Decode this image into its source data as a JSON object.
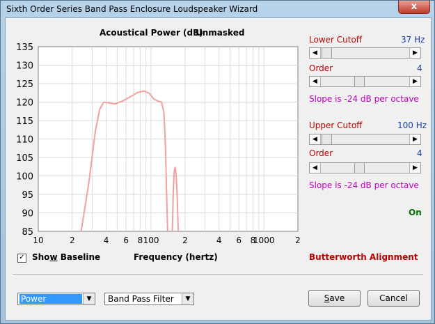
{
  "window": {
    "title": "Sixth Order Series Band Pass Enclosure Loudspeaker Wizard",
    "close_glyph": "x"
  },
  "chart": {
    "title": "Acoustical Power (dB)",
    "subtitle": "Unmasked"
  },
  "chart_data": {
    "type": "line",
    "title": "Acoustical Power (dB)",
    "subtitle": "Unmasked",
    "xlabel": "Frequency (hertz)",
    "ylabel": "",
    "x_scale": "log",
    "xlim": [
      10,
      2000
    ],
    "ylim": [
      85,
      135
    ],
    "grid": true,
    "y_ticks": [
      135,
      130,
      125,
      120,
      115,
      110,
      105,
      100,
      95,
      90,
      85
    ],
    "x_ticks": [
      {
        "value": 10,
        "label": "10"
      },
      {
        "value": 20,
        "label": "2"
      },
      {
        "value": 40,
        "label": "4"
      },
      {
        "value": 60,
        "label": "6"
      },
      {
        "value": 80,
        "label": "8"
      },
      {
        "value": 100,
        "label": "100"
      },
      {
        "value": 200,
        "label": "2"
      },
      {
        "value": 400,
        "label": "4"
      },
      {
        "value": 600,
        "label": "6"
      },
      {
        "value": 800,
        "label": "8"
      },
      {
        "value": 1000,
        "label": "1000"
      },
      {
        "value": 2000,
        "label": "2"
      }
    ],
    "line_color": "#f2a0a0",
    "series": [
      {
        "segments": [
          [
            [
              24,
              85
            ],
            [
              28,
              98
            ],
            [
              32,
              112
            ],
            [
              35,
              118
            ],
            [
              38,
              120
            ],
            [
              42,
              119.8
            ],
            [
              48,
              119.5
            ],
            [
              56,
              120.3
            ],
            [
              66,
              121.5
            ],
            [
              76,
              122.6
            ],
            [
              86,
              123
            ],
            [
              96,
              122.4
            ],
            [
              106,
              120.8
            ],
            [
              116,
              120.2
            ],
            [
              124,
              120
            ],
            [
              130,
              117
            ],
            [
              134,
              108
            ],
            [
              137,
              96
            ],
            [
              140,
              85
            ]
          ],
          [
            [
              154,
              85
            ],
            [
              157,
              95
            ],
            [
              160,
              101
            ],
            [
              163,
              102.3
            ],
            [
              166,
              101
            ],
            [
              170,
              95
            ],
            [
              174,
              85
            ]
          ]
        ]
      }
    ]
  },
  "lower": {
    "cutoff_label": "Lower Cutoff",
    "cutoff_value": "37 Hz",
    "order_label": "Order",
    "order_value": "4",
    "slope": "Slope is -24 dB per octave"
  },
  "upper": {
    "cutoff_label": "Upper Cutoff",
    "cutoff_value": "100 Hz",
    "order_label": "Order",
    "order_value": "4",
    "slope": "Slope is -24 dB per octave"
  },
  "status": {
    "on": "On",
    "alignment": "Butterworth Alignment"
  },
  "baseline": {
    "label_pre": "Sho",
    "label_u": "w",
    "label_post": " Baseline",
    "checked_glyph": "✓"
  },
  "controls": {
    "plot_type": "Power",
    "filter_type": "Band Pass Filter",
    "save_u": "S",
    "save_rest": "ave",
    "cancel": "Cancel"
  },
  "icons": {
    "left_arrow": "◀",
    "right_arrow": "▶",
    "drop_arrow": "▼"
  }
}
